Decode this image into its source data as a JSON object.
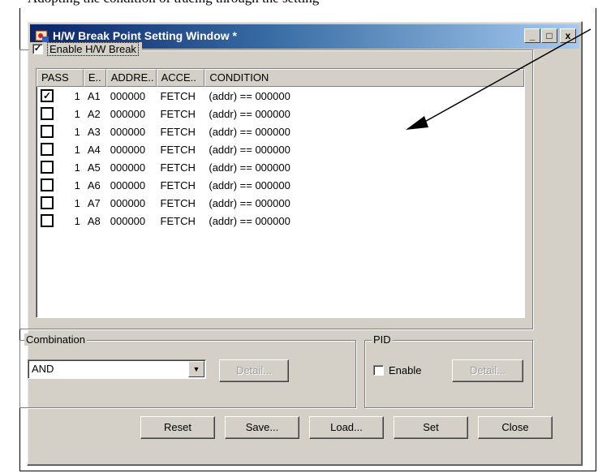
{
  "doc_text": "Adopting the condition of tracing through the setting",
  "window": {
    "title": "H/W Break Point Setting Window *",
    "controls": {
      "minimize": "_",
      "maximize": "□",
      "close": "x"
    }
  },
  "enable_hw_break": {
    "label": "Enable H/W Break",
    "checked": true,
    "check_mark": "✓"
  },
  "table": {
    "columns": [
      "PASS",
      "E..",
      "ADDRE..",
      "ACCE..",
      "CONDITION"
    ],
    "rows": [
      {
        "checked": "✓",
        "pass": "1",
        "event": "A1",
        "address": "000000",
        "access": "FETCH",
        "condition": "(addr) == 000000"
      },
      {
        "checked": "",
        "pass": "1",
        "event": "A2",
        "address": "000000",
        "access": "FETCH",
        "condition": "(addr) == 000000"
      },
      {
        "checked": "",
        "pass": "1",
        "event": "A3",
        "address": "000000",
        "access": "FETCH",
        "condition": "(addr) == 000000"
      },
      {
        "checked": "",
        "pass": "1",
        "event": "A4",
        "address": "000000",
        "access": "FETCH",
        "condition": "(addr) == 000000"
      },
      {
        "checked": "",
        "pass": "1",
        "event": "A5",
        "address": "000000",
        "access": "FETCH",
        "condition": "(addr) == 000000"
      },
      {
        "checked": "",
        "pass": "1",
        "event": "A6",
        "address": "000000",
        "access": "FETCH",
        "condition": "(addr) == 000000"
      },
      {
        "checked": "",
        "pass": "1",
        "event": "A7",
        "address": "000000",
        "access": "FETCH",
        "condition": "(addr) == 000000"
      },
      {
        "checked": "",
        "pass": "1",
        "event": "A8",
        "address": "000000",
        "access": "FETCH",
        "condition": "(addr) == 000000"
      }
    ]
  },
  "combination": {
    "label": "Combination",
    "value": "AND",
    "dropdown_glyph": "▼",
    "detail_label": "Detail..."
  },
  "pid": {
    "label": "PID",
    "enable_label": "Enable",
    "enable_checked": false,
    "detail_label": "Detail..."
  },
  "buttons": {
    "reset": "Reset",
    "save": "Save...",
    "load": "Load...",
    "set": "Set",
    "close": "Close"
  },
  "colors": {
    "titlebar_start": "#0a246a",
    "face": "#d4d0c8",
    "accent": "#000000"
  }
}
